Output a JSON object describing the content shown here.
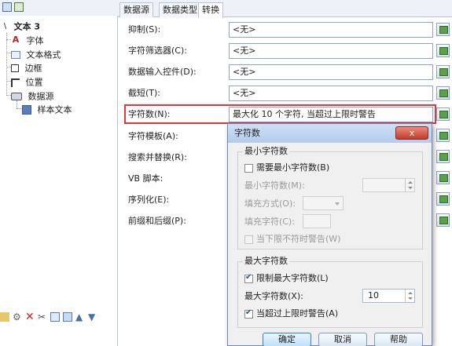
{
  "tree": {
    "root_label": "文本 3",
    "items": [
      {
        "label": "字体",
        "icon": "font-icon"
      },
      {
        "label": "文本格式",
        "icon": "text-format-icon"
      },
      {
        "label": "边框",
        "icon": "border-icon"
      },
      {
        "label": "位置",
        "icon": "position-icon"
      },
      {
        "label": "数据源",
        "icon": "datasource-icon"
      },
      {
        "label": "样本文本",
        "icon": "sample-text-icon"
      }
    ]
  },
  "tabs": [
    "数据源",
    "数据类型",
    "转换"
  ],
  "properties": [
    {
      "label": "抑制(S):",
      "value": "<无>"
    },
    {
      "label": "字符筛选器(C):",
      "value": "<无>"
    },
    {
      "label": "数据输入控件(D):",
      "value": "<无>"
    },
    {
      "label": "截短(T):",
      "value": "<无>"
    },
    {
      "label": "字符数(N):",
      "value": "最大化 10 个字符, 当超过上限时警告"
    },
    {
      "label": "字符模板(A):",
      "value": ""
    },
    {
      "label": "搜索并替换(R):",
      "value": ""
    },
    {
      "label": "VB 脚本:",
      "value": ""
    },
    {
      "label": "序列化(E):",
      "value": ""
    },
    {
      "label": "前缀和后缀(P):",
      "value": ""
    }
  ],
  "dialog": {
    "title": "字符数",
    "close_label": "x",
    "min_group": {
      "title": "最小字符数",
      "require_min_label": "需要最小字符数(B)",
      "require_min_checked": false,
      "min_count_label": "最小字符数(M):",
      "fill_mode_label": "填充方式(O):",
      "fill_char_label": "填充字符(C):",
      "warn_below_label": "当下限不符时警告(W)",
      "warn_below_checked": false
    },
    "max_group": {
      "title": "最大字符数",
      "limit_max_label": "限制最大字符数(L)",
      "limit_max_checked": true,
      "max_count_label": "最大字符数(X):",
      "max_count_value": "10",
      "warn_above_label": "当超过上限时警告(A)",
      "warn_above_checked": true
    },
    "buttons": {
      "ok": "确定",
      "cancel": "取消",
      "help": "帮助"
    }
  },
  "colors": {
    "highlight_border": "#e0383b",
    "tab_border": "#b9c5d6",
    "dialog_title": "#b4cbec",
    "close_button": "#c5392a"
  }
}
